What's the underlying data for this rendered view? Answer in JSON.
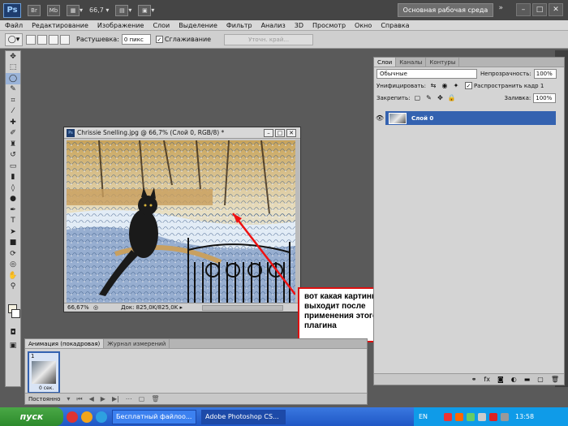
{
  "appbar": {
    "logo": "Ps",
    "zoom": "66,7",
    "workspace": "Основная рабочая среда",
    "more": "»",
    "minimize": "–",
    "maximize": "□",
    "close": "✕"
  },
  "menu": [
    "Файл",
    "Редактирование",
    "Изображение",
    "Слои",
    "Выделение",
    "Фильтр",
    "Анализ",
    "3D",
    "Просмотр",
    "Окно",
    "Справка"
  ],
  "options": {
    "feather_label": "Растушевка:",
    "feather_value": "0 пикс",
    "antialias_label": "Сглаживание",
    "refine_label": "Уточн. край..."
  },
  "document": {
    "title": "Chrissie Snelling.jpg @ 66,7% (Слой 0, RGB/8) *",
    "zoom": "66,67%",
    "doc_size": "Док: 825,0K/825,0K"
  },
  "callout": {
    "text": "вот какая картинка выходит после применения этого плагина"
  },
  "layers_panel": {
    "tabs": [
      "Слои",
      "Каналы",
      "Контуры"
    ],
    "blend_mode": "Обычные",
    "opacity_label": "Непрозрачность:",
    "opacity_value": "100%",
    "unify_label": "Унифицировать:",
    "propagate_label": "Распространить кадр 1",
    "lock_label": "Закрепить:",
    "fill_label": "Заливка:",
    "fill_value": "100%",
    "layer_name": "Слой 0"
  },
  "animation_panel": {
    "tabs": [
      "Анимация (покадровая)",
      "Журнал измерений"
    ],
    "frame_number": "1",
    "frame_delay": "0 сек.",
    "loop": "Постоянно"
  },
  "taskbar": {
    "start": "пуск",
    "tasks": [
      "Бесплатный файлоо...",
      "Adobe Photoshop CS..."
    ],
    "lang": "EN",
    "time": "13:58"
  },
  "colors": {
    "layer_selected": "#3462b0",
    "callout_border": "#dd1111",
    "taskbar": "#1f57c5"
  }
}
